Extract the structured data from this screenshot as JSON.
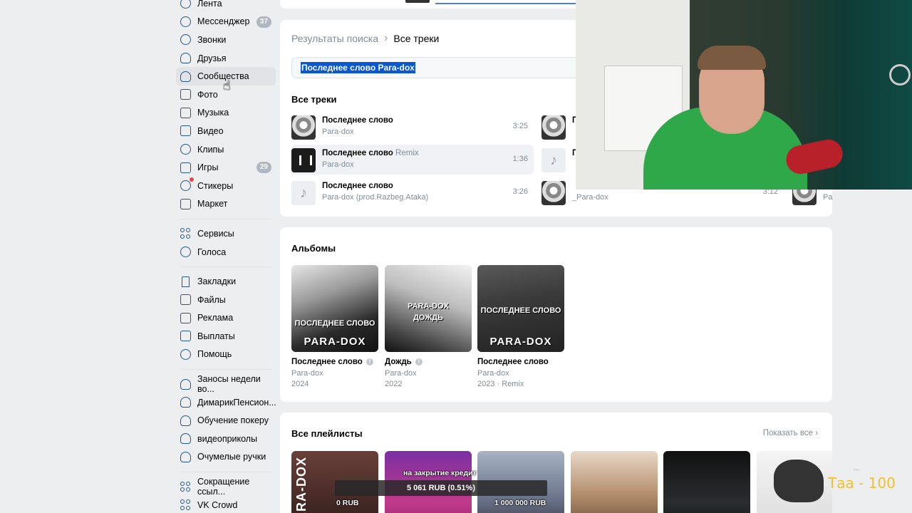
{
  "sidebar": {
    "items": [
      {
        "label": "Лента",
        "badge": ""
      },
      {
        "label": "Мессенджер",
        "badge": "37"
      },
      {
        "label": "Звонки",
        "badge": ""
      },
      {
        "label": "Друзья",
        "badge": ""
      },
      {
        "label": "Сообщества",
        "badge": ""
      },
      {
        "label": "Фото",
        "badge": ""
      },
      {
        "label": "Музыка",
        "badge": ""
      },
      {
        "label": "Видео",
        "badge": ""
      },
      {
        "label": "Клипы",
        "badge": ""
      },
      {
        "label": "Игры",
        "badge": "29"
      },
      {
        "label": "Стикеры",
        "badge": ""
      },
      {
        "label": "Маркет",
        "badge": ""
      }
    ],
    "items2": [
      {
        "label": "Сервисы"
      },
      {
        "label": "Голоса"
      }
    ],
    "items3": [
      {
        "label": "Закладки"
      },
      {
        "label": "Файлы"
      },
      {
        "label": "Реклама"
      },
      {
        "label": "Выплаты"
      },
      {
        "label": "Помощь"
      }
    ],
    "groups": [
      {
        "label": "Заносы недели во..."
      },
      {
        "label": "ДимарикПенсион..."
      },
      {
        "label": "Обучение покеру"
      },
      {
        "label": "видеоприколы"
      },
      {
        "label": "Очумелые ручки"
      }
    ],
    "apps": [
      {
        "label": "Сокращение ссыл..."
      },
      {
        "label": "VK Crowd"
      }
    ]
  },
  "breadcrumb": {
    "root": "Результаты поиска",
    "current": "Все треки"
  },
  "search": {
    "value": "Последнее слово Para-dox"
  },
  "tracks_section": {
    "title": "Все треки"
  },
  "tracks": [
    {
      "title": "Последнее слово",
      "subtitle": "",
      "artist": "Para-dox",
      "duration": "3:25"
    },
    {
      "title": "Последнее слово",
      "subtitle": "Remix",
      "artist": "Para-dox",
      "duration": "1:36"
    },
    {
      "title": "Последнее слово",
      "subtitle": "",
      "artist": "Para-dox (prod.Razbeg.Ataka)",
      "duration": "3:26"
    }
  ],
  "tracks_col2": [
    {
      "title": "П",
      "artist": ""
    },
    {
      "title": "П",
      "artist": ""
    },
    {
      "title": "",
      "artist": "_Para-dox",
      "duration": "3:12"
    }
  ],
  "tracks_col3": [
    {
      "artist": "Pa"
    }
  ],
  "albums_section": {
    "title": "Альбомы"
  },
  "albums": [
    {
      "title": "Последнее слово",
      "artist": "Para-dox",
      "year": "2024",
      "explicit": true,
      "cover_text": "PARA-DOX",
      "cover_sub": "ПОСЛЕДНЕЕ СЛОВО"
    },
    {
      "title": "Дождь",
      "artist": "Para-dox",
      "year": "2022",
      "explicit": true,
      "cover_text": "ДОЖДЬ",
      "cover_sub": "PARA-DOX"
    },
    {
      "title": "Последнее слово",
      "artist": "Para-dox",
      "year": "2023 · Remix",
      "explicit": false,
      "cover_text": "PARA-DOX",
      "cover_sub": "ПОСЛЕДНЕЕ СЛОВО"
    }
  ],
  "playlists_section": {
    "title": "Все плейлисты",
    "show_all": "Показать все"
  },
  "playlists": [
    {
      "cover_text": "PARA-DOX"
    }
  ],
  "donation": {
    "label": "на закрытие кредит",
    "amount": "5 061 RUB (0.51%)",
    "min": "0 RUB",
    "max": "1 000 000 RUB"
  },
  "overlay": {
    "text": "Таа - 100",
    "dots": "..."
  },
  "colors": {
    "accent": "#2a5885",
    "link": "#5181b8",
    "badge": "#aeb7c2",
    "highlight": "#0b57d0",
    "overlay_text": "#f0c030"
  }
}
